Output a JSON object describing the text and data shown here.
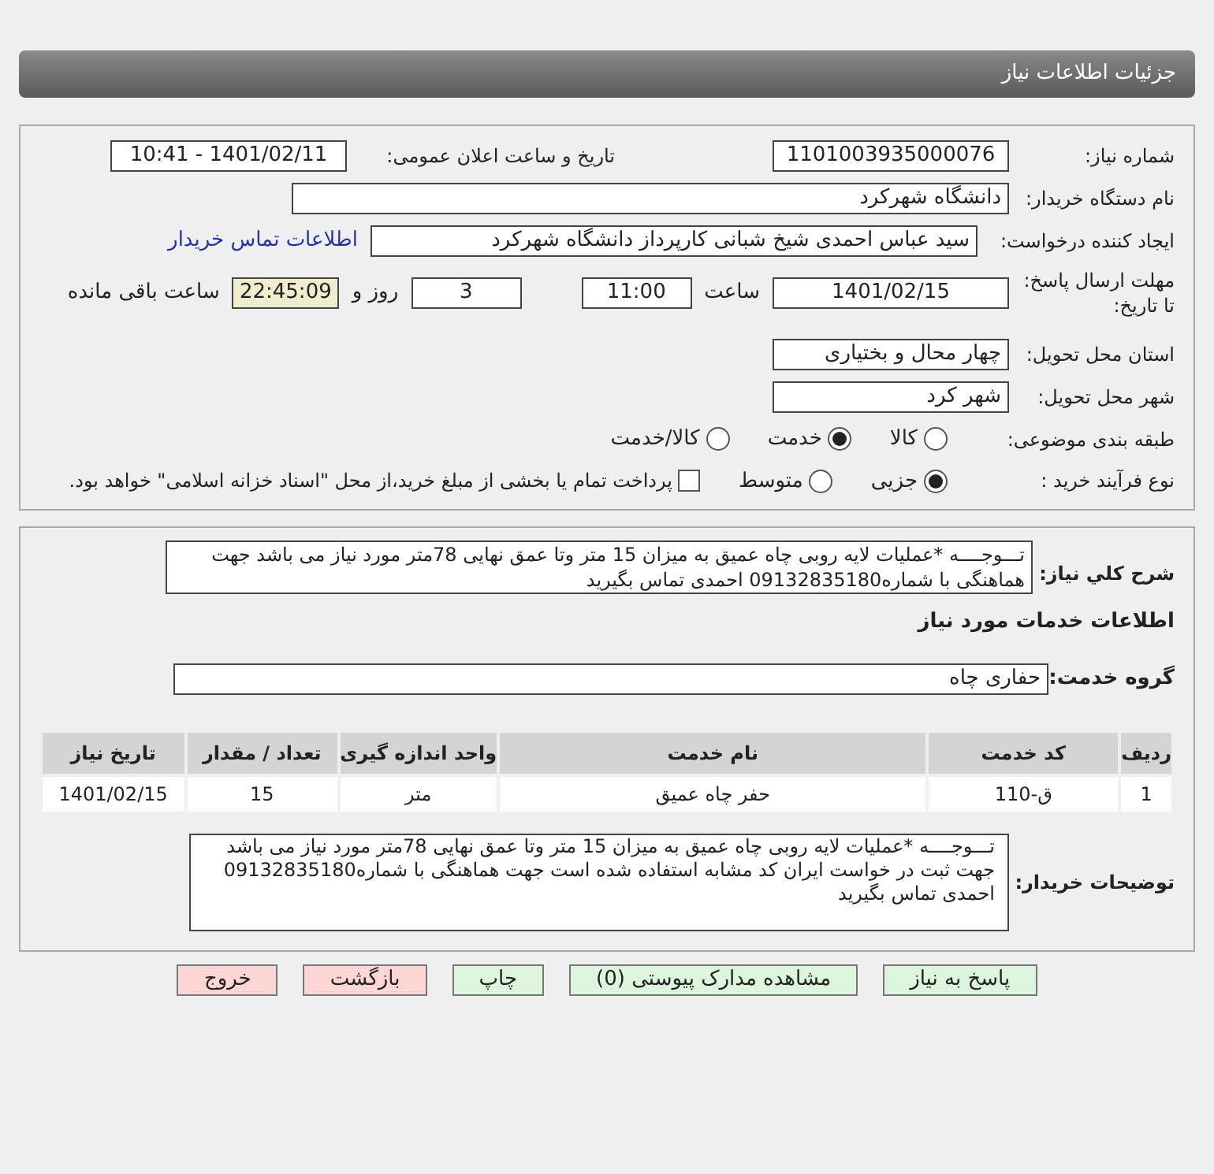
{
  "header": {
    "title": "جزئیات اطلاعات نیاز"
  },
  "details": {
    "need_number_label": "شماره نیاز:",
    "need_number": "1101003935000076",
    "announce_label": "تاریخ و ساعت اعلان عمومی:",
    "announce_value": "1401/02/11 - 10:41",
    "buyer_label": "نام دستگاه خریدار:",
    "buyer": "دانشگاه شهرکرد",
    "creator_label": "ایجاد کننده درخواست:",
    "creator": "سید عباس احمدی شیخ شبانی کارپرداز دانشگاه شهرکرد",
    "contact_link": "اطلاعات تماس خریدار",
    "deadline_label": "مهلت ارسال پاسخ: تا تاریخ:",
    "deadline_date": "1401/02/15",
    "time_label": "ساعت",
    "deadline_time": "11:00",
    "days": "3",
    "days_label": "روز و",
    "remaining": "22:45:09",
    "remaining_label": "ساعت باقی مانده",
    "province_label": "استان محل تحویل:",
    "province": "چهار محال و بختیاری",
    "city_label": "شهر محل تحویل:",
    "city": "شهر کرد",
    "category_label": "طبقه بندی موضوعی:",
    "category_options": [
      {
        "label": "کالا",
        "selected": false
      },
      {
        "label": "خدمت",
        "selected": true
      },
      {
        "label": "کالا/خدمت",
        "selected": false
      }
    ],
    "process_label": "نوع فرآیند خرید :",
    "process_options": [
      {
        "label": "جزیی",
        "selected": true
      },
      {
        "label": "متوسط",
        "selected": false
      }
    ],
    "payment_checkbox": {
      "label": "پرداخت تمام یا بخشی از مبلغ خرید،از محل \"اسناد خزانه اسلامی\" خواهد بود.",
      "checked": false
    }
  },
  "summary": {
    "label": "شرح کلي نياز:",
    "text": "تـــوجــــه  *عملیات لایه روبی چاه عمیق به میزان 15 متر وتا عمق نهایی 78متر مورد نیاز می باشد  جهت هماهنگی با شماره09132835180 احمدی تماس بگیرید",
    "services_title": "اطلاعات خدمات مورد نیاز",
    "group_label": "گروه خدمت:",
    "group": "حفاری چاه",
    "table": {
      "columns": [
        "ردیف",
        "کد خدمت",
        "نام خدمت",
        "واحد اندازه گیری",
        "تعداد / مقدار",
        "تاریخ نیاز"
      ],
      "rows": [
        [
          "1",
          "ق-110",
          "حفر چاه عمیق",
          "متر",
          "15",
          "1401/02/15"
        ]
      ]
    },
    "notes_label": "توضیحات خریدار:",
    "notes": "تـــوجــــه  *عملیات لایه روبی چاه عمیق به میزان 15 متر وتا عمق نهایی 78متر مورد نیاز می باشد جهت ثبت در خواست ایران کد مشابه استفاده شده است جهت هماهنگی با شماره09132835180 احمدی تماس بگیرید"
  },
  "buttons": [
    {
      "label": "پاسخ به نیاز",
      "kind": "action"
    },
    {
      "label": "مشاهده مدارک پیوستی (0)",
      "kind": "action"
    },
    {
      "label": "چاپ",
      "kind": "action"
    },
    {
      "label": "بازگشت",
      "kind": "exit"
    },
    {
      "label": "خروج",
      "kind": "exit"
    }
  ]
}
